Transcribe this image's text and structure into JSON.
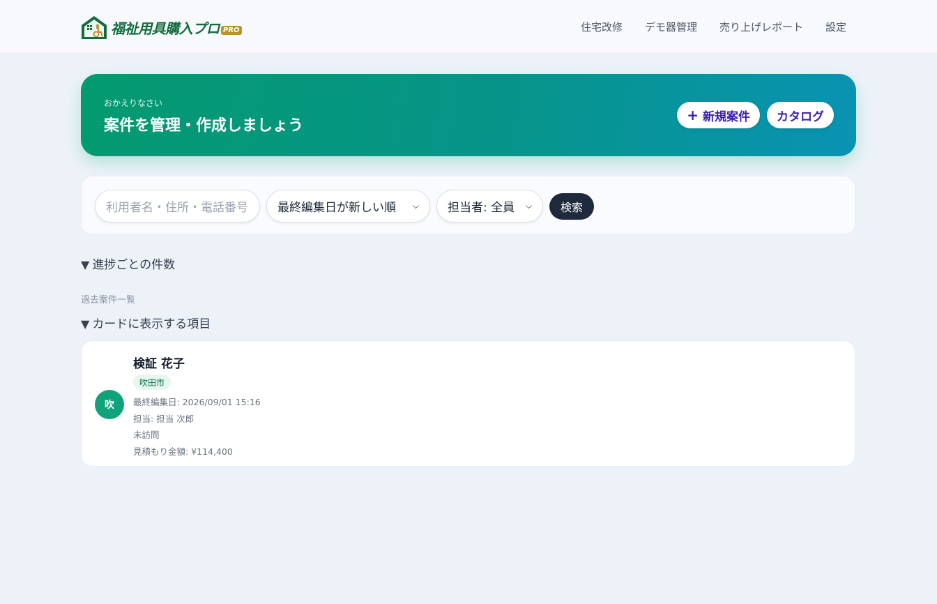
{
  "header": {
    "logo_text": "福祉用具購入プロ",
    "logo_badge": "PRO",
    "nav": [
      "住宅改修",
      "デモ器管理",
      "売り上げレポート",
      "設定"
    ]
  },
  "hero": {
    "subtitle": "おかえりなさい",
    "title": "案件を管理・作成しましょう",
    "new_case_label": "新規案件",
    "catalog_label": "カタログ"
  },
  "search": {
    "placeholder": "利用者名・住所・電話番号",
    "sort_selected": "最終編集日が新しい順",
    "staff_selected": "担当者: 全員",
    "button_label": "検索"
  },
  "sections": {
    "progress_summary": "進捗ごとの件数",
    "list_label": "過去案件一覧",
    "card_fields": "カードに表示する項目"
  },
  "cases": [
    {
      "avatar": "吹",
      "name": "検証 花子",
      "city": "吹田市",
      "last_edited": "最終編集日: 2026/09/01 15:16",
      "staff": "担当: 担当 次郎",
      "status": "未訪問",
      "estimate": "見積もり金額: ¥114,400"
    }
  ],
  "colors": {
    "brand_green": "#126b3d",
    "hero_start": "#049a6f",
    "hero_end": "#0a93b3",
    "accent_purple": "#3b1fa8",
    "dark_button": "#1e293b"
  },
  "icons": {
    "logo": "house-with-wheelchair-icon",
    "new_case": "plus-icon",
    "select": "chevron-down-icon",
    "disclosure": "triangle-down-icon"
  }
}
